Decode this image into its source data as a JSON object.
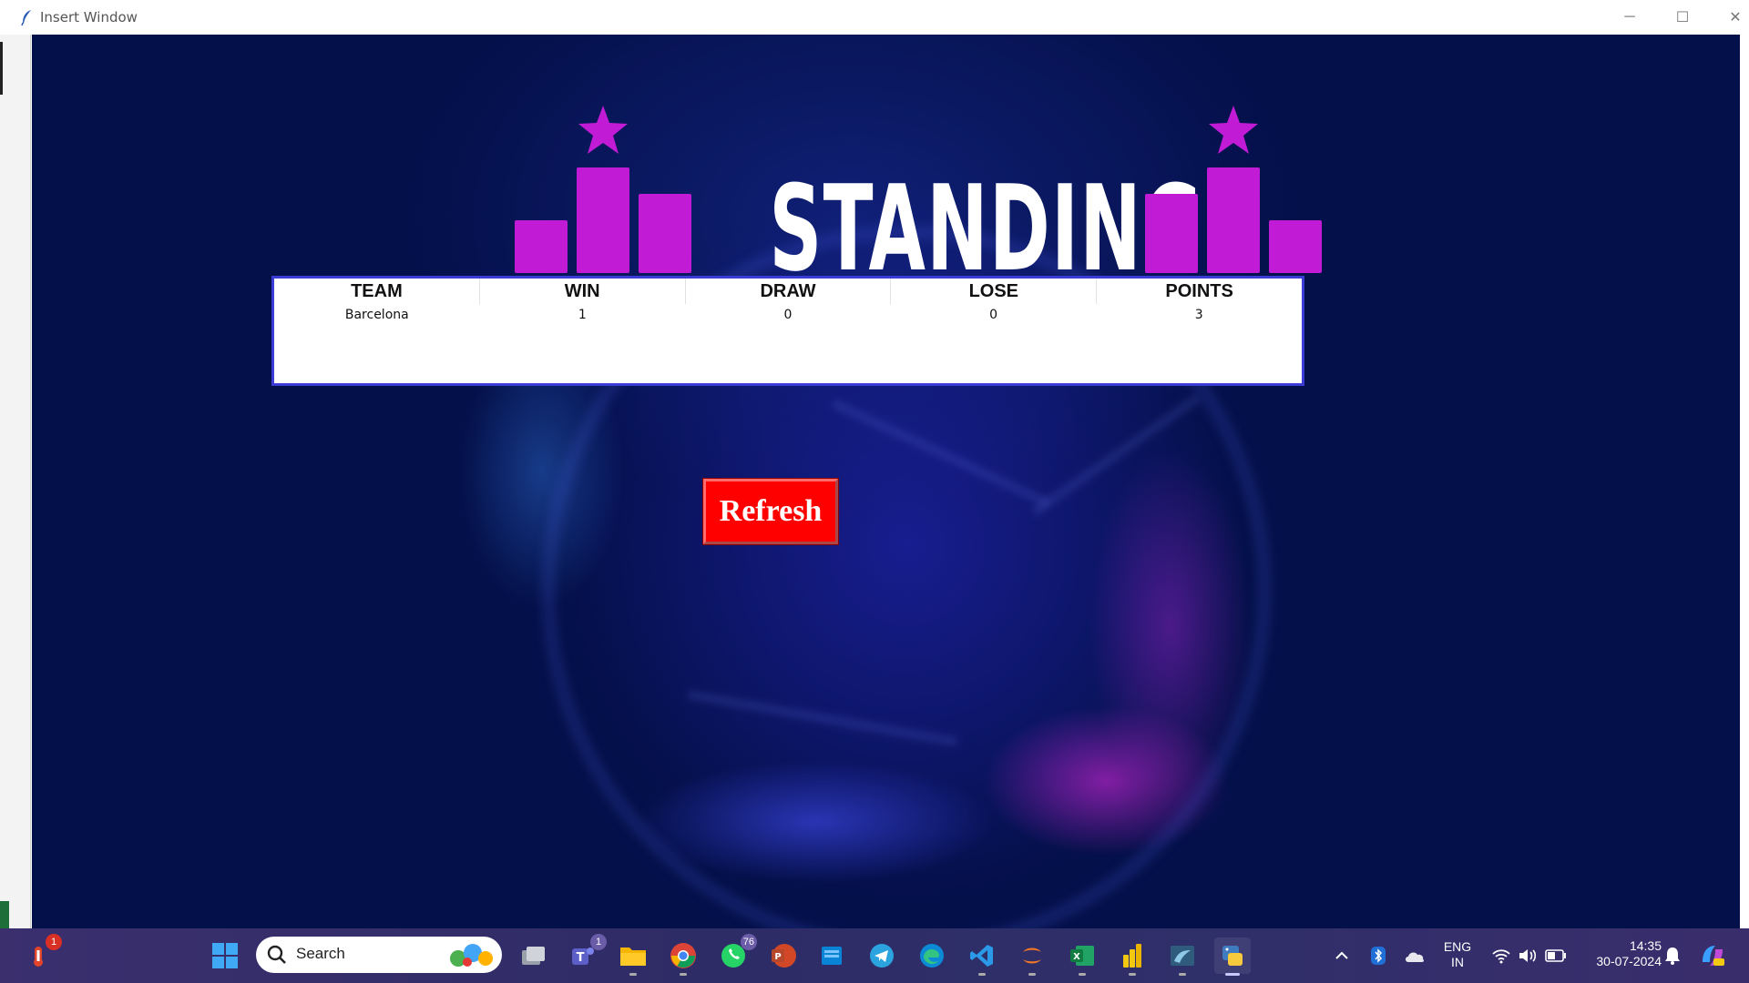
{
  "window": {
    "title": "Insert Window",
    "controls": {
      "minimize": "─",
      "maximize": "☐",
      "close": "✕"
    }
  },
  "logo": {
    "text": "STANDING",
    "accent_color": "#c21bd6"
  },
  "table": {
    "columns": [
      "TEAM",
      "WIN",
      "DRAW",
      "LOSE",
      "POINTS"
    ],
    "rows": [
      [
        "Barcelona",
        "1",
        "0",
        "0",
        "3"
      ]
    ]
  },
  "refresh_button": {
    "label": "Refresh",
    "color": "#ff0000"
  },
  "taskbar": {
    "search_placeholder": "Search",
    "badges": {
      "widgets": "1",
      "teams": "1",
      "whatsapp": "76"
    },
    "tray": {
      "language_line1": "ENG",
      "language_line2": "IN",
      "time": "14:35",
      "date": "30-07-2024"
    }
  }
}
